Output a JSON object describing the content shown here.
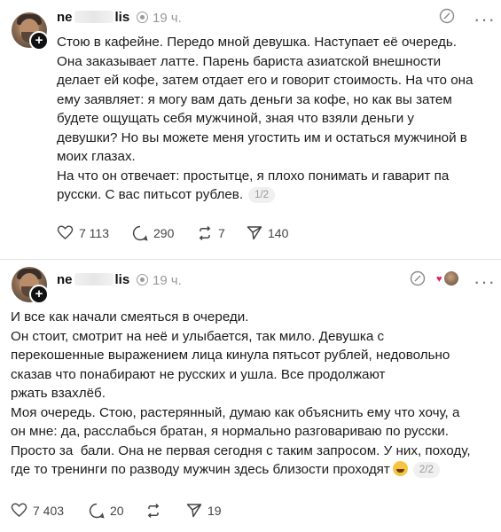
{
  "posts": [
    {
      "username_start": "ne",
      "username_end": "lis",
      "time": "19 ч.",
      "text": "Стою в кафейне. Передо мной девушка. Наступает её очередь.\nОна заказывает латте. Парень бариста азиатской внешности\nделает ей кофе, затем отдает его и говорит стоимость. На что она\nему заявляет: я могу вам дать деньги за кофе, но как вы затем\nбудете ощущать себя мужчиной, зная что взяли деньги у\nдевушки? Но вы можете меня угостить им и остаться мужчиной в\nмоих глазах.\nНа что он отвечает: простытце, я плохо понимать и гаварит па\nрусски. С вас питьсот рублев.",
      "pager": "1/2",
      "likes": "7 113",
      "comments": "290",
      "reposts": "7",
      "shares": "140"
    },
    {
      "username_start": "ne",
      "username_end": "lis",
      "time": "19 ч.",
      "text": "И все как начали смеяться в очереди.\nОн стоит, смотрит на неё и улыбается, так мило. Девушка с\nперекошенные выражением лица кинула пятьсот рублей, недовольно\nсказав что понабирают не русских и ушла. Все продолжают\nржать взахлёб.\nМоя очередь. Стою, растерянный, думаю как объяснить ему что хочу, а\nон мне: да, расслабься братан, я нормально разговариваю по русски.\nПросто за  бали. Она не первая сегодня с таким запросом. У них, походу,\nгде то тренинги по разводу мужчин здесь близости проходят",
      "pager": "2/2",
      "likes": "7 403",
      "comments": "20",
      "reposts": "",
      "shares": "19"
    }
  ],
  "icons": {
    "verified": "verified-badge-icon",
    "edit": "edit-circle-icon",
    "more": "more-dots-icon",
    "like": "heart-icon",
    "comment": "comment-bubble-icon",
    "repost": "repost-icon",
    "share": "send-icon",
    "emoji": "laughing-emoji-icon"
  },
  "colors": {
    "like_accent": "#e0245e",
    "muted": "#9a9a9a"
  }
}
